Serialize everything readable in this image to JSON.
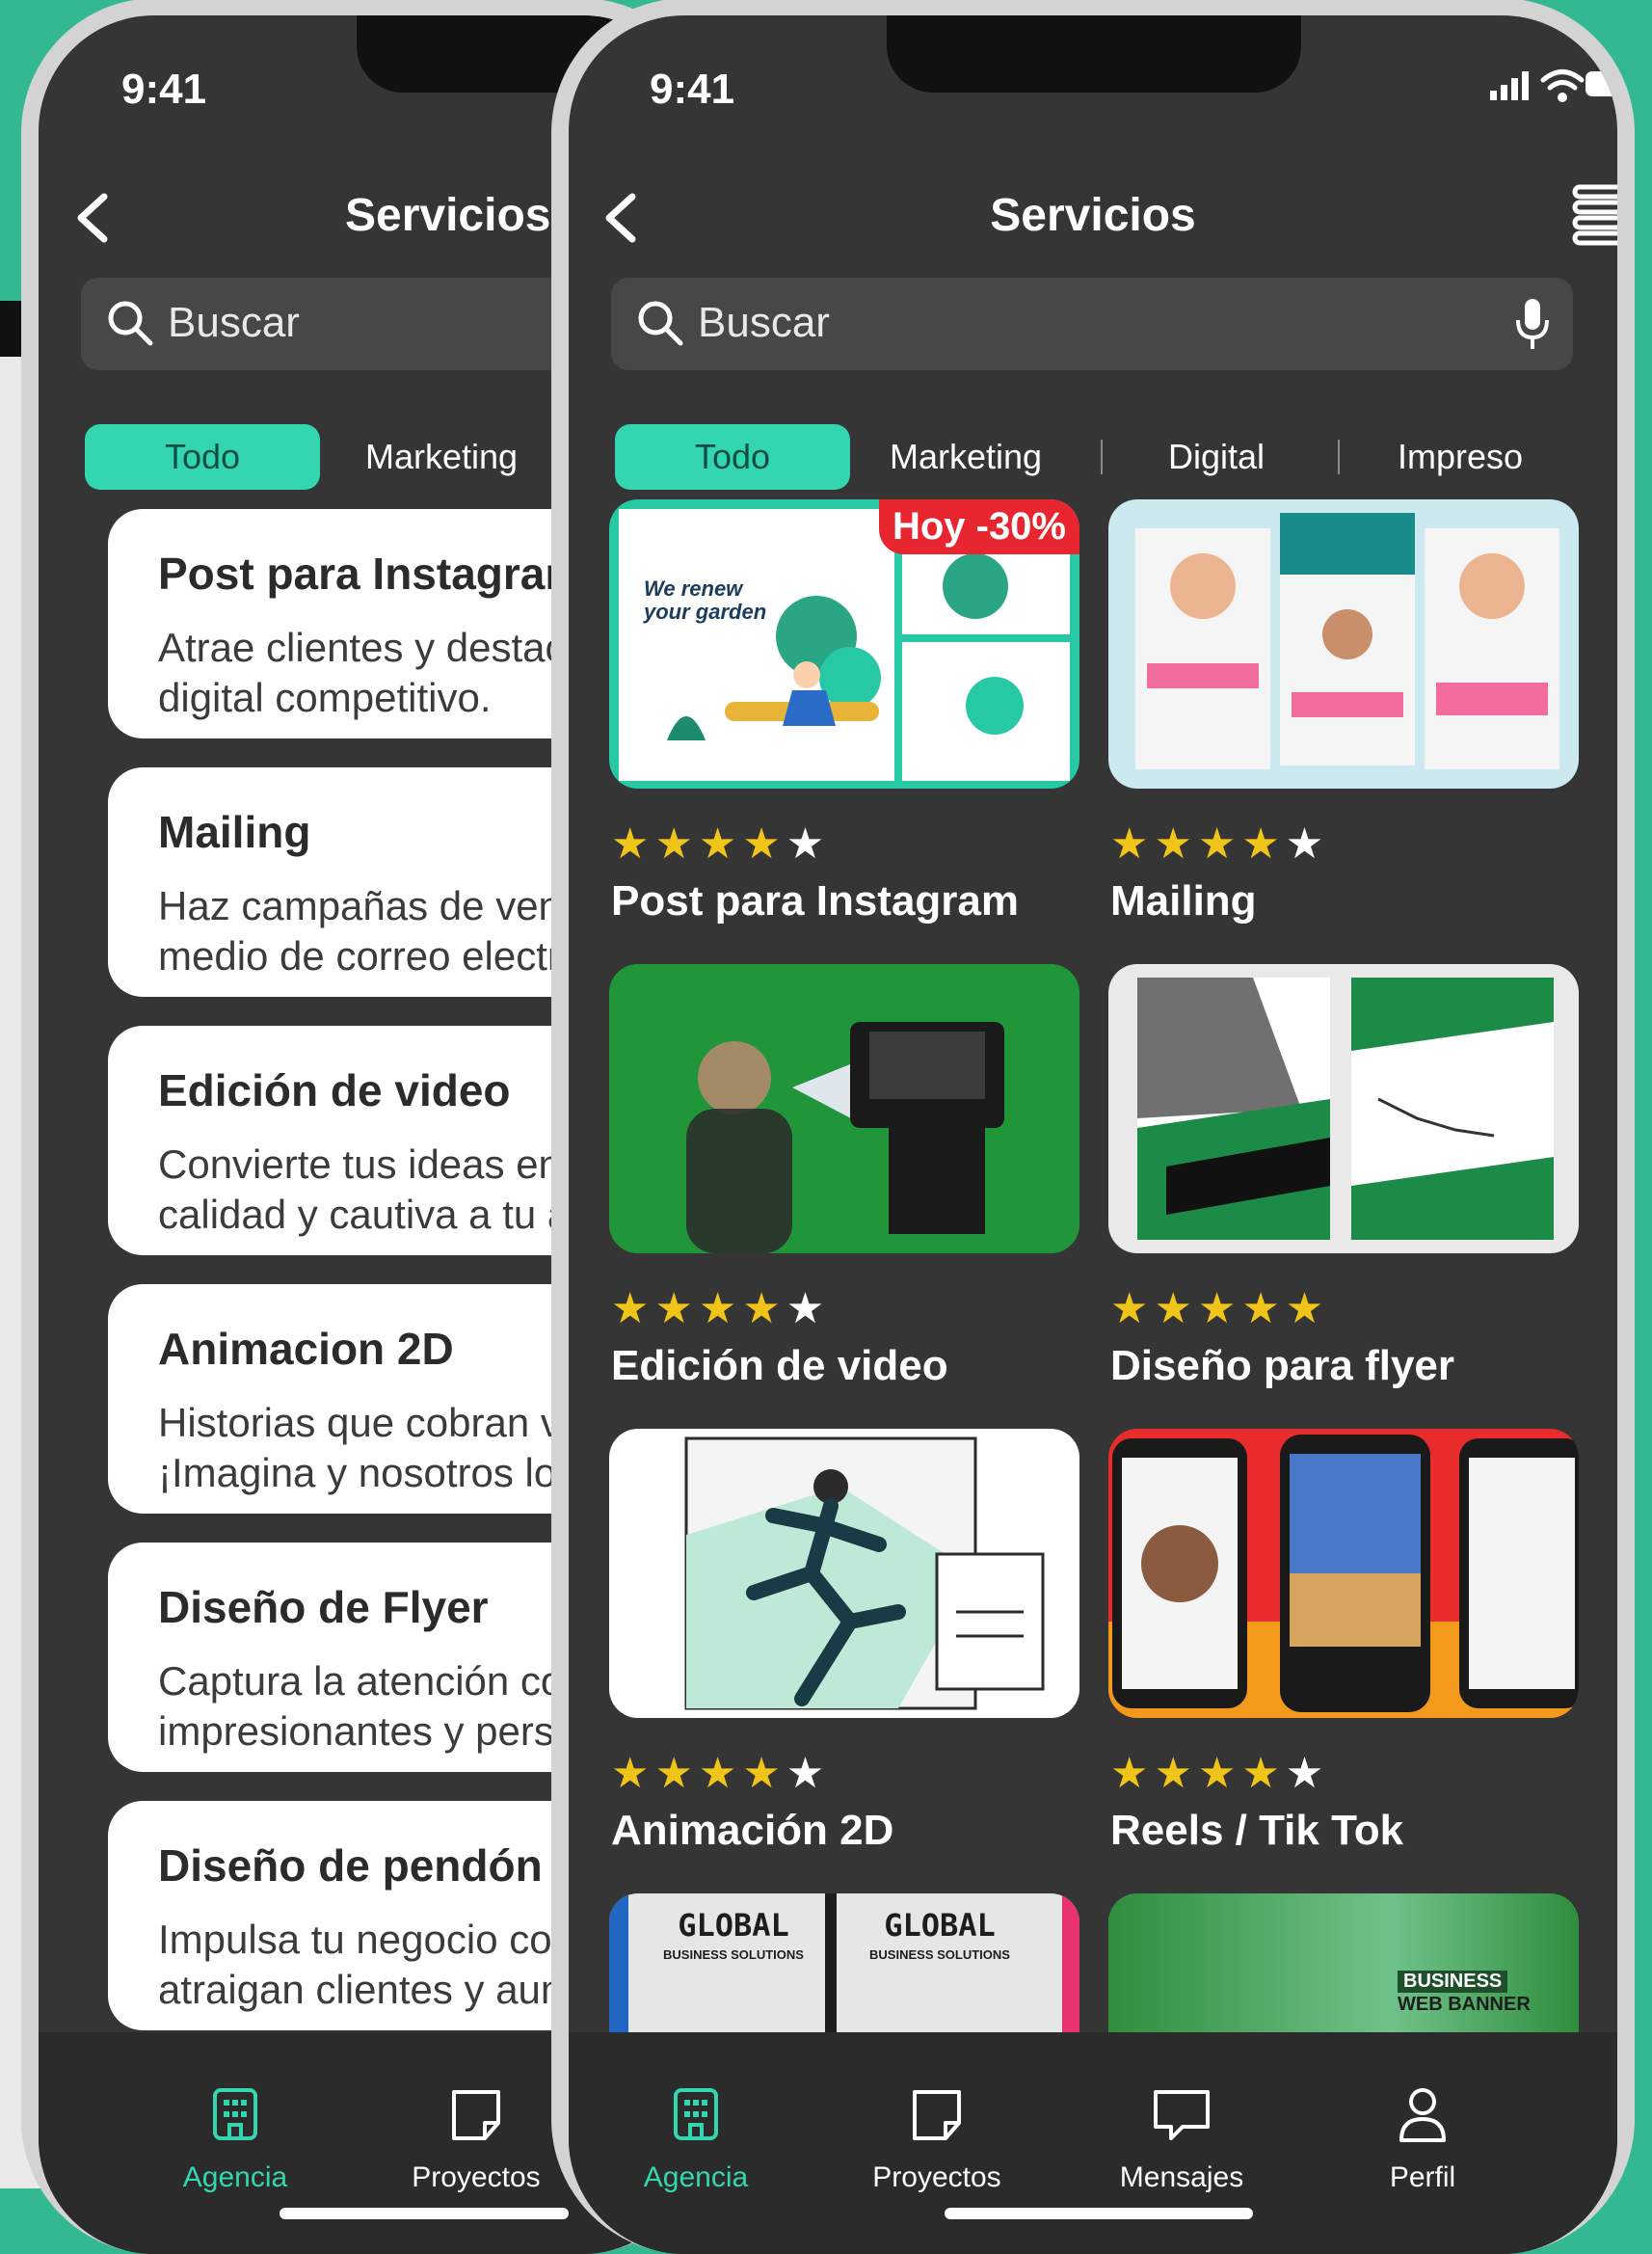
{
  "status": {
    "time": "9:41"
  },
  "left": {
    "title": "Servicios",
    "search_placeholder": "Buscar",
    "chips": [
      "Todo",
      "Marketing"
    ],
    "cards": [
      {
        "title": "Post para Instagram",
        "description": "Atrae clientes y destaca en el mercado\ndigital competitivo."
      },
      {
        "title": "Mailing",
        "description": "Haz campañas de ventas\nmedio de correo electrónico"
      },
      {
        "title": "Edición de video",
        "description": "Convierte tus ideas en contenido de\ncalidad y cautiva a tu audiencia"
      },
      {
        "title": "Animacion 2D",
        "description": "Historias que cobran vida.\n¡Imagina y nosotros lo animamos!"
      },
      {
        "title": "Diseño de Flyer",
        "description": "Captura la atención con diseños\nimpresionantes y personalizados"
      },
      {
        "title": "Diseño de pendón",
        "description": "Impulsa tu negocio con pendones que\natraigan clientes y aumenten ventas"
      }
    ],
    "tabs": [
      "Agencia",
      "Proyectos"
    ]
  },
  "right": {
    "title": "Servicios",
    "search_placeholder": "Buscar",
    "chips": [
      "Todo",
      "Marketing",
      "Digital",
      "Impreso"
    ],
    "tiles": [
      {
        "title": "Post para Instagram",
        "rating": 4,
        "badge": "Hoy -30%"
      },
      {
        "title": "Mailing",
        "rating": 4
      },
      {
        "title": "Edición de video",
        "rating": 4
      },
      {
        "title": "Diseño para flyer",
        "rating": 5
      },
      {
        "title": "Animación 2D",
        "rating": 4
      },
      {
        "title": "Reels / Tik Tok",
        "rating": 4
      }
    ],
    "partial_tiles": [
      {
        "text_a": "GLOBAL",
        "text_b": "BUSINESS SOLUTIONS"
      },
      {
        "text_a": "BUSINESS",
        "text_b": "WEB BANNER"
      }
    ],
    "tabs": [
      "Agencia",
      "Proyectos",
      "Mensajes",
      "Perfil"
    ]
  },
  "colors": {
    "accent": "#34d6b0",
    "background": "#34b893",
    "screen": "#353535",
    "star": "#f1c419",
    "badge": "#e8262f"
  }
}
